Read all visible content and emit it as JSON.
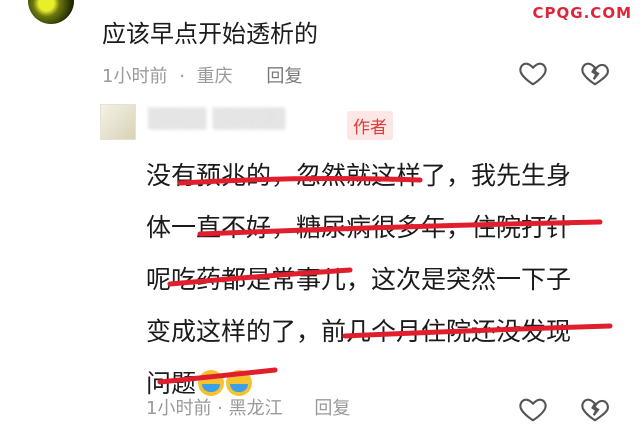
{
  "watermark": "CPQG.COM",
  "comment": {
    "text": "应该早点开始透析的",
    "time": "1小时前",
    "dot": "·",
    "location": "重庆",
    "reply_label": "回复"
  },
  "reply": {
    "author_badge": "作者",
    "lines": [
      "没有预兆的，忽然就这样了，我先生身",
      "体一直不好，糖尿病很多年，住院打针",
      "呢吃药都是常事儿，这次是突然一下子",
      "变成这样的了，前几个月住院还没发现",
      "问题"
    ],
    "emoji_names": [
      "crying-face-emoji",
      "crying-face-emoji"
    ],
    "time": "1小时前",
    "dot": "·",
    "location": "黑龙江",
    "reply_label": "回复"
  },
  "colors": {
    "underline": "#e01e2e",
    "badge_bg": "#fde6e6",
    "badge_text": "#e03a3a",
    "watermark": "#e0243a"
  }
}
